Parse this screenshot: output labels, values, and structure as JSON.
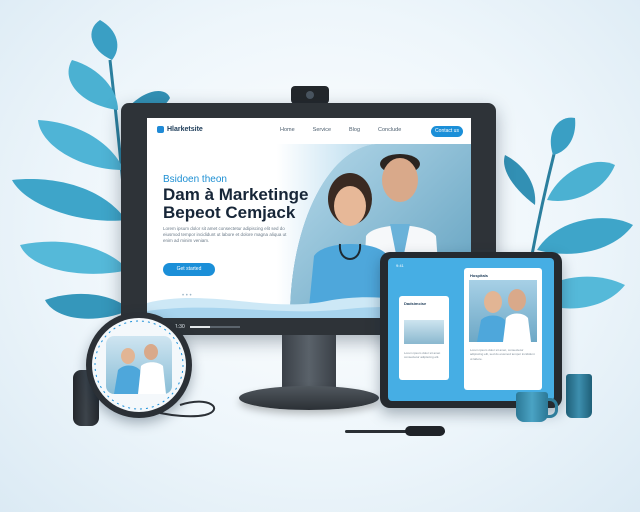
{
  "website": {
    "logo": "Hlarketsite",
    "nav_links": [
      "Home",
      "Service",
      "Blog",
      "Conclude"
    ],
    "nav_cta": "Contact us",
    "eyebrow": "Bsidoen theon",
    "headline_line1": "Dam à Marketinge",
    "headline_line2": "Bepeot Cemjack",
    "body_copy": "Lorem ipsum dolor sit amet consectetur adipiscing elit sed do eiusmod tempor incididunt ut labore et dolore magna aliqua ut enim ad minim veniam.",
    "hero_button": "Get started",
    "slider_dots": "• • •"
  },
  "player": {
    "time": "1:30",
    "progress": 0.4
  },
  "tablet": {
    "status": "9:41",
    "left_card_title": "Dadsimcise",
    "left_card_text": "Lorem ipsum dolor sit amet consectetur adipiscing elit.",
    "right_card_title": "Hospitals",
    "right_card_text": "Lorem ipsum dolor sit amet, consectetur adipiscing elit, sed do eiusmod tempor incididunt ut labore."
  },
  "colors": {
    "accent": "#1b8fd8",
    "leaf": "#3b9fc2",
    "device": "#2e3338"
  }
}
